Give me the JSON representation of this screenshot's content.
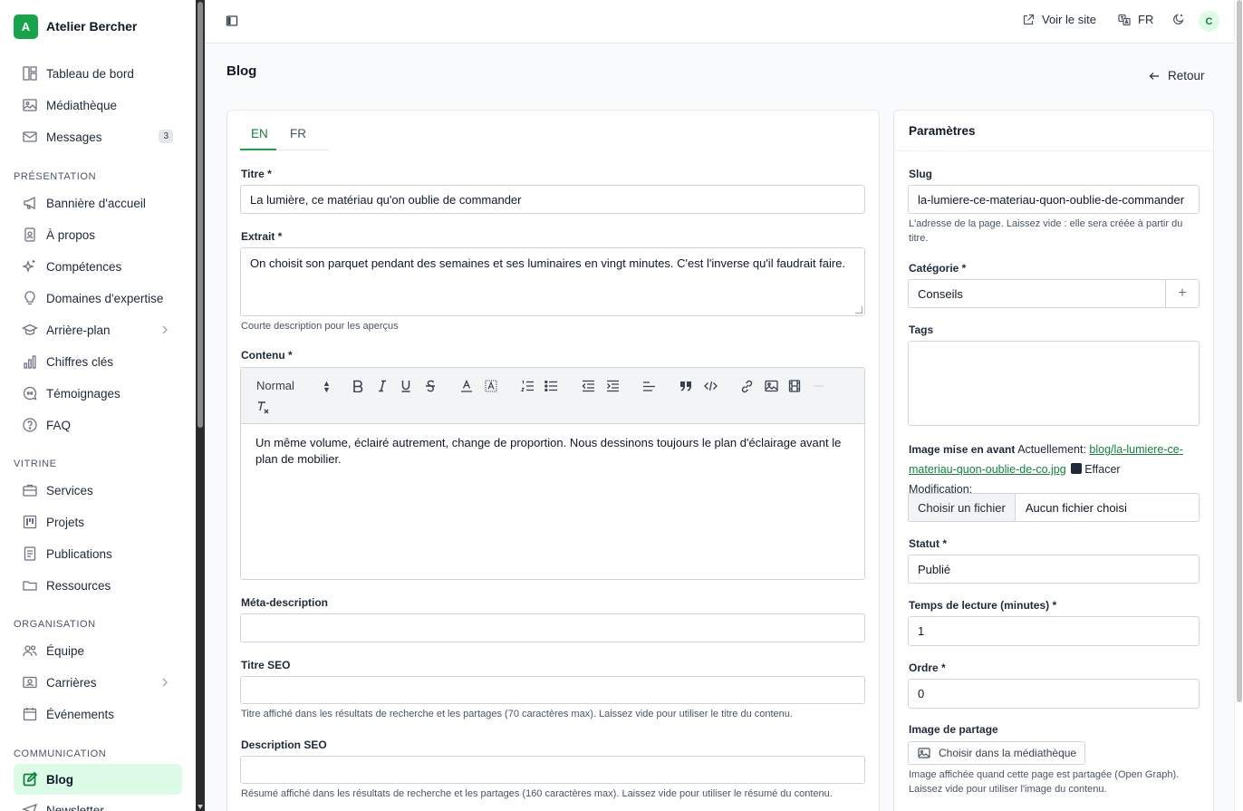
{
  "brand": {
    "logo_letter": "A",
    "name": "Atelier Bercher"
  },
  "sidebar": {
    "top_items": [
      {
        "label": "Tableau de bord",
        "icon": "dashboard-icon"
      },
      {
        "label": "Médiathèque",
        "icon": "image-icon"
      },
      {
        "label": "Messages",
        "icon": "mail-icon",
        "count": "3"
      }
    ],
    "sections": {
      "presentation": "PRÉSENTATION",
      "vitrine": "VITRINE",
      "organisation": "ORGANISATION",
      "communication": "COMMUNICATION"
    },
    "presentation_items": [
      {
        "label": "Bannière d'accueil",
        "icon": "megaphone-icon"
      },
      {
        "label": "À propos",
        "icon": "id-badge-icon"
      },
      {
        "label": "Compétences",
        "icon": "sparkles-icon"
      },
      {
        "label": "Domaines d'expertise",
        "icon": "lightbulb-icon"
      },
      {
        "label": "Arrière-plan",
        "icon": "graduation-cap-icon"
      },
      {
        "label": "Chiffres clés",
        "icon": "bar-chart-icon"
      },
      {
        "label": "Témoignages",
        "icon": "quote-bubble-icon"
      },
      {
        "label": "FAQ",
        "icon": "question-circle-icon"
      }
    ],
    "vitrine_items": [
      {
        "label": "Services",
        "icon": "briefcase-icon"
      },
      {
        "label": "Projets",
        "icon": "kanban-icon"
      },
      {
        "label": "Publications",
        "icon": "document-icon"
      },
      {
        "label": "Ressources",
        "icon": "folder-icon"
      }
    ],
    "organisation_items": [
      {
        "label": "Équipe",
        "icon": "users-icon"
      },
      {
        "label": "Carrières",
        "icon": "id-card-icon"
      },
      {
        "label": "Événements",
        "icon": "calendar-icon"
      }
    ],
    "communication_items": [
      {
        "label": "Blog",
        "icon": "edit-icon"
      },
      {
        "label": "Newsletter",
        "icon": "send-icon"
      }
    ]
  },
  "topbar": {
    "view_site": "Voir le site",
    "language": "FR",
    "avatar_letter": "C"
  },
  "page": {
    "title": "Blog",
    "back_label": "Retour"
  },
  "form": {
    "tabs": [
      "EN",
      "FR"
    ],
    "title_label": "Titre *",
    "title_value": "La lumière, ce matériau qu'on oublie de commander",
    "excerpt_label": "Extrait *",
    "excerpt_value": "On choisit son parquet pendant des semaines et ses luminaires en vingt minutes. C'est l'inverse qu'il faudrait faire.",
    "excerpt_help": "Courte description pour les aperçus",
    "content_label": "Contenu *",
    "editor_format": "Normal",
    "content_value": "Un même volume, éclairé autrement, change de proportion. Nous dessinons toujours le plan d'éclairage avant le plan de mobilier.",
    "meta_label": "Méta-description",
    "meta_value": "",
    "seo_title_label": "Titre SEO",
    "seo_title_value": "",
    "seo_title_help": "Titre affiché dans les résultats de recherche et les partages (70 caractères max). Laissez vide pour utiliser le titre du contenu.",
    "seo_desc_label": "Description SEO",
    "seo_desc_value": "",
    "seo_desc_help": "Résumé affiché dans les résultats de recherche et les partages (160 caractères max). Laissez vide pour utiliser le résumé du contenu."
  },
  "settings": {
    "title": "Paramètres",
    "slug_label": "Slug",
    "slug_value": "la-lumiere-ce-materiau-quon-oublie-de-commander",
    "slug_help": "L'adresse de la page. Laissez vide : elle sera créée à partir du titre.",
    "category_label": "Catégorie *",
    "category_value": "Conseils",
    "add_symbol": "+",
    "tags_label": "Tags",
    "image_label": "Image mise en avant",
    "current_prefix": "Actuellement:",
    "current_link": "blog/la-lumiere-ce-materiau-quon-oublie-de-co.jpg",
    "clear_label": "Effacer",
    "change_label": "Modification:",
    "file_button": "Choisir un fichier",
    "file_none": "Aucun fichier choisi",
    "status_label": "Statut *",
    "status_value": "Publié",
    "reading_label": "Temps de lecture (minutes) *",
    "reading_value": "1",
    "order_label": "Ordre *",
    "order_value": "0",
    "share_label": "Image de partage",
    "share_button": "Choisir dans la médiathèque",
    "share_help": "Image affichée quand cette page est partagée (Open Graph). Laissez vide pour utiliser l'image du contenu."
  },
  "colors": {
    "accent": "#16a34a",
    "active_bg": "#dcfce7",
    "link": "#15803d"
  }
}
